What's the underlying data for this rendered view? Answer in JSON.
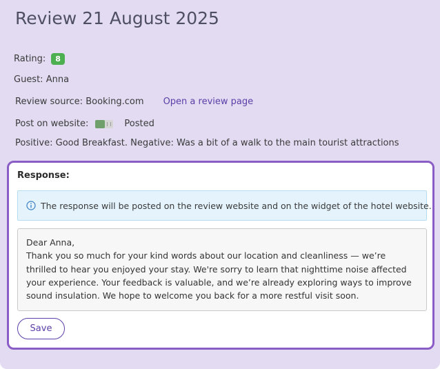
{
  "header": {
    "title": "Review 21 August 2025"
  },
  "review": {
    "rating_label": "Rating:",
    "rating_value": "8",
    "guest_text": "Guest: Anna",
    "source_text": "Review source: Booking.com",
    "source_link": "Open a review page",
    "post_label": "Post on website:",
    "post_status": "Posted",
    "post_enabled": true,
    "comment_text": "Positive: Good Breakfast. Negative: Was a bit of a walk to the main tourist attractions"
  },
  "response": {
    "heading": "Response:",
    "info_icon": "info-circle-icon",
    "info_text": "The response will be posted on the review website and on the widget of the hotel website.",
    "text": "Dear Anna,\nThank you so much for your kind words about our location and cleanliness — we’re thrilled to hear you enjoyed your stay. We're sorry to learn that nighttime noise affected your experience. Your feedback is valuable, and we’re already exploring ways to improve sound insulation. We hope to welcome you back for a more restful visit soon.",
    "save_label": "Save"
  },
  "colors": {
    "panel_bg": "#e3dbf2",
    "accent": "#5b3ea8",
    "card_border": "#8a5cc6",
    "rating_badge": "#4caf50",
    "toggle_on": "#6fa06b",
    "info_bg": "#e4f3fc"
  }
}
